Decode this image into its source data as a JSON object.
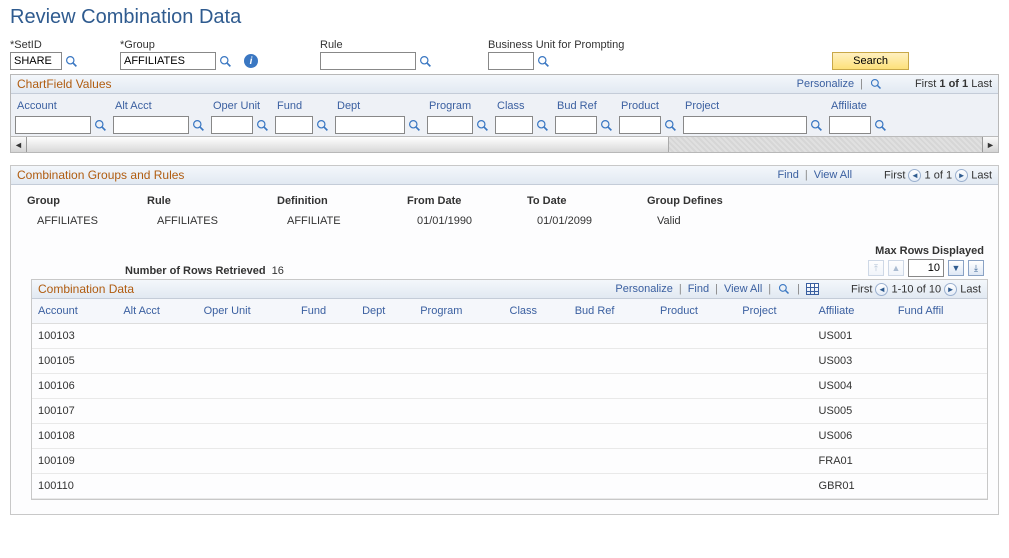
{
  "page_title": "Review Combination Data",
  "filters": {
    "setid": {
      "label": "*SetID",
      "value": "SHARE"
    },
    "group": {
      "label": "*Group",
      "value": "AFFILIATES"
    },
    "rule": {
      "label": "Rule",
      "value": ""
    },
    "bu": {
      "label": "Business Unit for Prompting",
      "value": ""
    },
    "search_label": "Search"
  },
  "chartfield": {
    "title": "ChartField Values",
    "personalize": "Personalize",
    "paging_first": "First",
    "paging_range": "1 of 1",
    "paging_last": "Last",
    "columns": [
      "Account",
      "Alt Acct",
      "Oper Unit",
      "Fund",
      "Dept",
      "Program",
      "Class",
      "Bud Ref",
      "Product",
      "Project",
      "Affiliate"
    ]
  },
  "combo_group": {
    "title": "Combination Groups and Rules",
    "find": "Find",
    "view_all": "View All",
    "first": "First",
    "range": "1 of 1",
    "last": "Last",
    "headers": {
      "group": "Group",
      "rule": "Rule",
      "definition": "Definition",
      "from_date": "From Date",
      "to_date": "To Date",
      "group_defines": "Group Defines"
    },
    "row": {
      "group": "AFFILIATES",
      "rule": "AFFILIATES",
      "definition": "AFFILIATE",
      "from_date": "01/01/1990",
      "to_date": "01/01/2099",
      "group_defines": "Valid"
    }
  },
  "rows_retrieved": {
    "label": "Number of Rows Retrieved",
    "value": "16",
    "max_rows_label": "Max Rows Displayed",
    "max_rows_value": "10"
  },
  "combo_data": {
    "title": "Combination Data",
    "personalize": "Personalize",
    "find": "Find",
    "view_all": "View All",
    "first": "First",
    "range": "1-10 of 10",
    "last": "Last",
    "columns": [
      "Account",
      "Alt Acct",
      "Oper Unit",
      "Fund",
      "Dept",
      "Program",
      "Class",
      "Bud Ref",
      "Product",
      "Project",
      "Affiliate",
      "Fund Affil"
    ],
    "rows": [
      {
        "account": "100103",
        "affiliate": "US001"
      },
      {
        "account": "100105",
        "affiliate": "US003"
      },
      {
        "account": "100106",
        "affiliate": "US004"
      },
      {
        "account": "100107",
        "affiliate": "US005"
      },
      {
        "account": "100108",
        "affiliate": "US006"
      },
      {
        "account": "100109",
        "affiliate": "FRA01"
      },
      {
        "account": "100110",
        "affiliate": "GBR01"
      }
    ]
  }
}
